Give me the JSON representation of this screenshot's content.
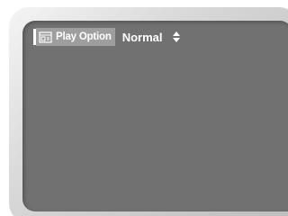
{
  "osd": {
    "option_label": "Play Option",
    "option_value": "Normal",
    "icon": "play-option-icon",
    "adjust_icon": "up-down-arrows-icon"
  },
  "colors": {
    "screen": "#717171",
    "label_highlight": "#9e9e9e",
    "text": "#ffffff"
  }
}
